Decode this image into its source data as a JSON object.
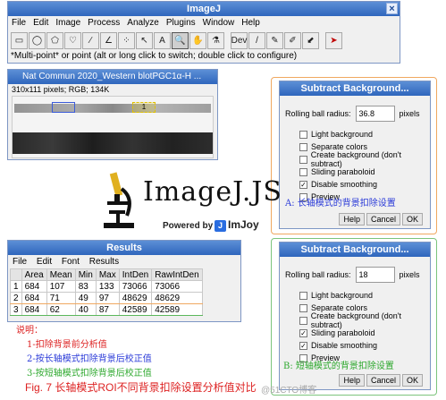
{
  "imagej": {
    "title": "ImageJ",
    "close": "×",
    "menu": [
      "File",
      "Edit",
      "Image",
      "Process",
      "Analyze",
      "Plugins",
      "Window",
      "Help"
    ],
    "tools": [
      "▭",
      "◯",
      "⬠",
      "♡",
      "∕",
      "∠",
      "⁘",
      "↖",
      "A",
      "🔍",
      "✋",
      "⚗",
      "Dev",
      "/",
      "✎",
      "✐",
      "⬋",
      "➤"
    ],
    "status": "*Multi-point* or point (alt or long click to switch; double click to configure)"
  },
  "blot": {
    "title": "Nat Commun 2020_Western blotPGC1α-H ...",
    "info": "310x111 pixels; RGB; 134K",
    "roi_label": "1"
  },
  "dialog_a": {
    "title": "Subtract Background...",
    "radius_label": "Rolling ball radius:",
    "radius_value": "36.8",
    "unit": "pixels",
    "options": [
      {
        "label": "Light background",
        "checked": false
      },
      {
        "label": "Separate colors",
        "checked": false
      },
      {
        "label": "Create background (don't subtract)",
        "checked": false
      },
      {
        "label": "Sliding paraboloid",
        "checked": false
      },
      {
        "label": "Disable smoothing",
        "checked": true
      },
      {
        "label": "Preview",
        "checked": false
      }
    ],
    "buttons": [
      "Help",
      "Cancel",
      "OK"
    ],
    "caption": "A: 长轴模式的背景扣除设置"
  },
  "dialog_b": {
    "title": "Subtract Background...",
    "radius_label": "Rolling ball radius:",
    "radius_value": "18",
    "unit": "pixels",
    "options": [
      {
        "label": "Light background",
        "checked": false
      },
      {
        "label": "Separate colors",
        "checked": false
      },
      {
        "label": "Create background (don't subtract)",
        "checked": false
      },
      {
        "label": "Sliding paraboloid",
        "checked": true
      },
      {
        "label": "Disable smoothing",
        "checked": true
      },
      {
        "label": "Preview",
        "checked": false
      }
    ],
    "buttons": [
      "Help",
      "Cancel",
      "OK"
    ],
    "caption": "B: 短轴模式的背景扣除设置"
  },
  "logo": {
    "text": "ImageJ.JS",
    "powered": "Powered by",
    "imjoy": "ImJoy"
  },
  "results": {
    "title": "Results",
    "menu": [
      "File",
      "Edit",
      "Font",
      "Results"
    ],
    "columns": [
      "",
      "Area",
      "Mean",
      "Min",
      "Max",
      "IntDen",
      "RawIntDen"
    ],
    "rows": [
      [
        "1",
        "684",
        "107",
        "83",
        "133",
        "73066",
        "73066"
      ],
      [
        "2",
        "684",
        "71",
        "49",
        "97",
        "48629",
        "48629"
      ],
      [
        "3",
        "684",
        "62",
        "40",
        "87",
        "42589",
        "42589"
      ]
    ]
  },
  "notes": {
    "title": "说明：",
    "items": [
      "1-扣除背景前分析值",
      "2-按长轴模式扣除背景后校正值",
      "3-按短轴模式扣除背景后校正值"
    ]
  },
  "figure_caption": "Fig. 7 长轴模式ROI不同背景扣除设置分析值对比",
  "watermark": "@51CTO博客",
  "colors": {
    "titlebar": "#2f66bd",
    "caption_red": "#dd2222",
    "caption_blue": "#2a3ad8",
    "caption_green": "#2da82d",
    "frame_orange": "#f0a860",
    "frame_green": "#7cc47c"
  }
}
